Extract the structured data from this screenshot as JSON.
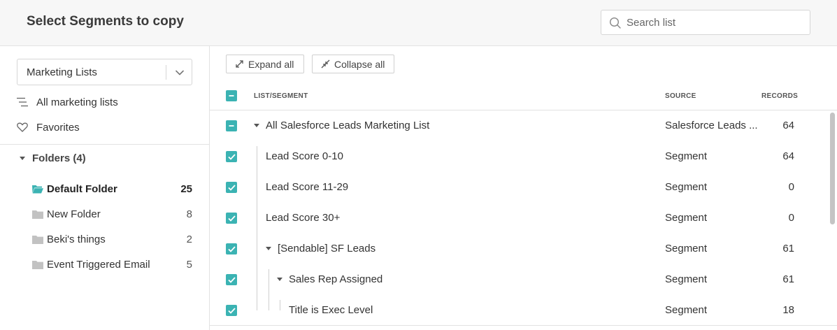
{
  "header": {
    "title": "Select Segments to copy"
  },
  "search": {
    "placeholder": "Search list"
  },
  "sidebar": {
    "dropdown": {
      "selected": "Marketing Lists"
    },
    "links": {
      "all_lists": "All marketing lists",
      "favorites": "Favorites"
    },
    "folders_heading": "Folders (4)",
    "folders": [
      {
        "name": "Default Folder",
        "count": "25",
        "active": true
      },
      {
        "name": "New Folder",
        "count": "8"
      },
      {
        "name": "Beki's things",
        "count": "2"
      },
      {
        "name": "Event Triggered Email",
        "count": "5"
      }
    ]
  },
  "toolbar": {
    "expand_label": "Expand all",
    "collapse_label": "Collapse all"
  },
  "table": {
    "columns": {
      "name": "LIST/SEGMENT",
      "source": "SOURCE",
      "records": "RECORDS"
    },
    "rows": [
      {
        "name": "All Salesforce Leads Marketing List",
        "source": "Salesforce Leads ...",
        "records": "64"
      },
      {
        "name": "Lead Score 0-10",
        "source": "Segment",
        "records": "64"
      },
      {
        "name": "Lead Score 11-29",
        "source": "Segment",
        "records": "0"
      },
      {
        "name": "Lead Score 30+",
        "source": "Segment",
        "records": "0"
      },
      {
        "name": "[Sendable] SF Leads",
        "source": "Segment",
        "records": "61"
      },
      {
        "name": "Sales Rep Assigned",
        "source": "Segment",
        "records": "61"
      },
      {
        "name": "Title is Exec Level",
        "source": "Segment",
        "records": "18"
      }
    ]
  },
  "colors": {
    "accent": "#3bb3b3",
    "header_bg": "#f7f7f7",
    "border": "#e2e2e2"
  }
}
